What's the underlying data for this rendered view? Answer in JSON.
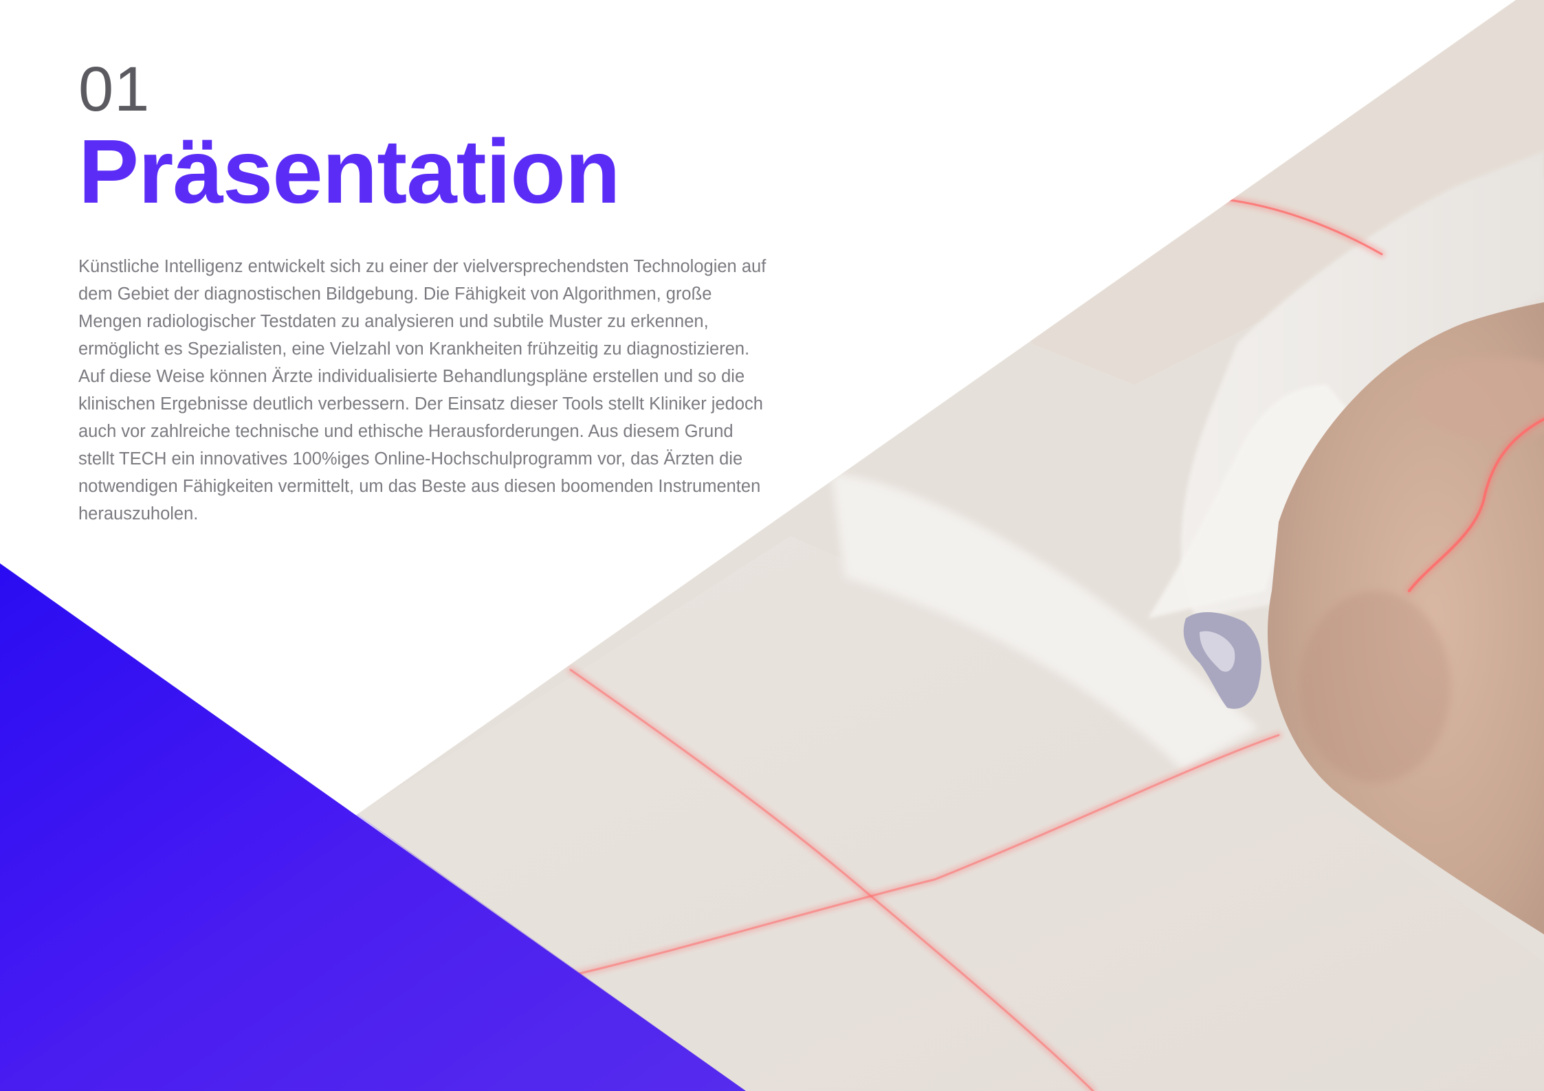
{
  "section": {
    "number": "01",
    "title": "Präsentation"
  },
  "body": {
    "paragraph": "Künstliche Intelligenz entwickelt sich zu einer der vielversprechendsten Technologien auf dem Gebiet der diagnostischen Bildgebung. Die Fähigkeit von Algorithmen, große Mengen radiologischer Testdaten zu analysieren und subtile Muster zu erkennen, ermöglicht es Spezialisten, eine Vielzahl von Krankheiten frühzeitig zu diagnostizieren. Auf diese Weise können Ärzte individualisierte Behandlungspläne erstellen und so die klinischen Ergebnisse deutlich verbessern. Der Einsatz dieser Tools stellt Kliniker jedoch auch vor zahlreiche technische und ethische Herausforderungen. Aus diesem Grund stellt TECH ein innovatives 100%iges Online-Hochschulprogramm vor, das Ärzten die notwendigen Fähigkeiten vermittelt, um das Beste aus diesen boomenden Instrumenten herauszuholen."
  },
  "colors": {
    "accent": "#5b2cf6",
    "triangle_start": "#2a0cf2",
    "triangle_end": "#5a2ff0"
  }
}
